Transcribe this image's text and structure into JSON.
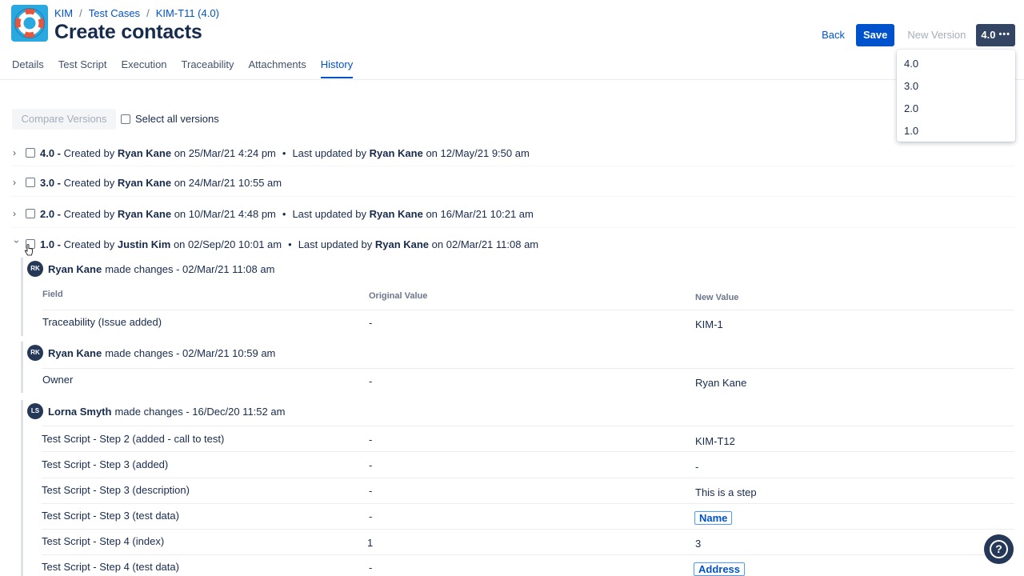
{
  "breadcrumb": {
    "project": "KIM",
    "section": "Test Cases",
    "item": "KIM-T11 (4.0)"
  },
  "page_title": "Create contacts",
  "actions": {
    "back": "Back",
    "save": "Save",
    "new_version": "New Version",
    "version": "4.0",
    "more_glyph": "•••"
  },
  "version_menu": [
    "4.0",
    "3.0",
    "2.0",
    "1.0"
  ],
  "tabs": [
    "Details",
    "Test Script",
    "Execution",
    "Traceability",
    "Attachments",
    "History"
  ],
  "active_tab": "History",
  "compare": {
    "button": "Compare Versions",
    "select_all": "Select all versions"
  },
  "versions": [
    {
      "id": "4.0 -",
      "created_label": "Created by",
      "created_by": "Ryan Kane",
      "created_on": "on 25/Mar/21 4:24 pm",
      "updated_label": "Last updated by",
      "updated_by": "Ryan Kane",
      "updated_on": "on 12/May/21 9:50 am"
    },
    {
      "id": "3.0 -",
      "created_label": "Created by",
      "created_by": "Ryan Kane",
      "created_on": "on 24/Mar/21 10:55 am"
    },
    {
      "id": "2.0 -",
      "created_label": "Created by",
      "created_by": "Ryan Kane",
      "created_on": "on 10/Mar/21 4:48 pm",
      "updated_label": "Last updated by",
      "updated_by": "Ryan Kane",
      "updated_on": "on 16/Mar/21 10:21 am"
    },
    {
      "id": "1.0 -",
      "created_label": "Created by",
      "created_by": "Justin Kim",
      "created_on": "on 02/Sep/20 10:01 am",
      "updated_label": "Last updated by",
      "updated_by": "Ryan Kane",
      "updated_on": "on 02/Mar/21 11:08 am"
    }
  ],
  "table_headers": {
    "field": "Field",
    "original": "Original Value",
    "new": "New Value"
  },
  "changes": [
    {
      "initials": "RK",
      "author": "Ryan Kane",
      "summary": "made changes - 02/Mar/21 11:08 am",
      "rows": [
        {
          "field": "Traceability (Issue added)",
          "original": "-",
          "new": "KIM-1"
        }
      ]
    },
    {
      "initials": "RK",
      "author": "Ryan Kane",
      "summary": "made changes - 02/Mar/21 10:59 am",
      "rows": [
        {
          "field": "Owner",
          "original": "-",
          "new": "Ryan Kane"
        }
      ]
    },
    {
      "initials": "LS",
      "author": "Lorna Smyth",
      "summary": "made changes - 16/Dec/20 11:52 am",
      "rows": [
        {
          "field": "Test Script - Step 2 (added - call to test)",
          "original": "-",
          "new": "KIM-T12"
        },
        {
          "field": "Test Script - Step 3 (added)",
          "original": "-",
          "new": "-"
        },
        {
          "field": "Test Script - Step 3 (description)",
          "original": "-",
          "new": "This is a step"
        },
        {
          "field": "Test Script - Step 3 (test data)",
          "original": "-",
          "new": "Name",
          "tag": true
        },
        {
          "field": "Test Script - Step 4 (index)",
          "original": "1",
          "new": "3"
        },
        {
          "field": "Test Script - Step 4 (test data)",
          "original": "-",
          "new": "Address",
          "tag": true
        }
      ]
    }
  ],
  "colors": {
    "accent": "#0052cc",
    "dark": "#253858",
    "version_button": "#344563",
    "logo": "#2aa8e0"
  }
}
